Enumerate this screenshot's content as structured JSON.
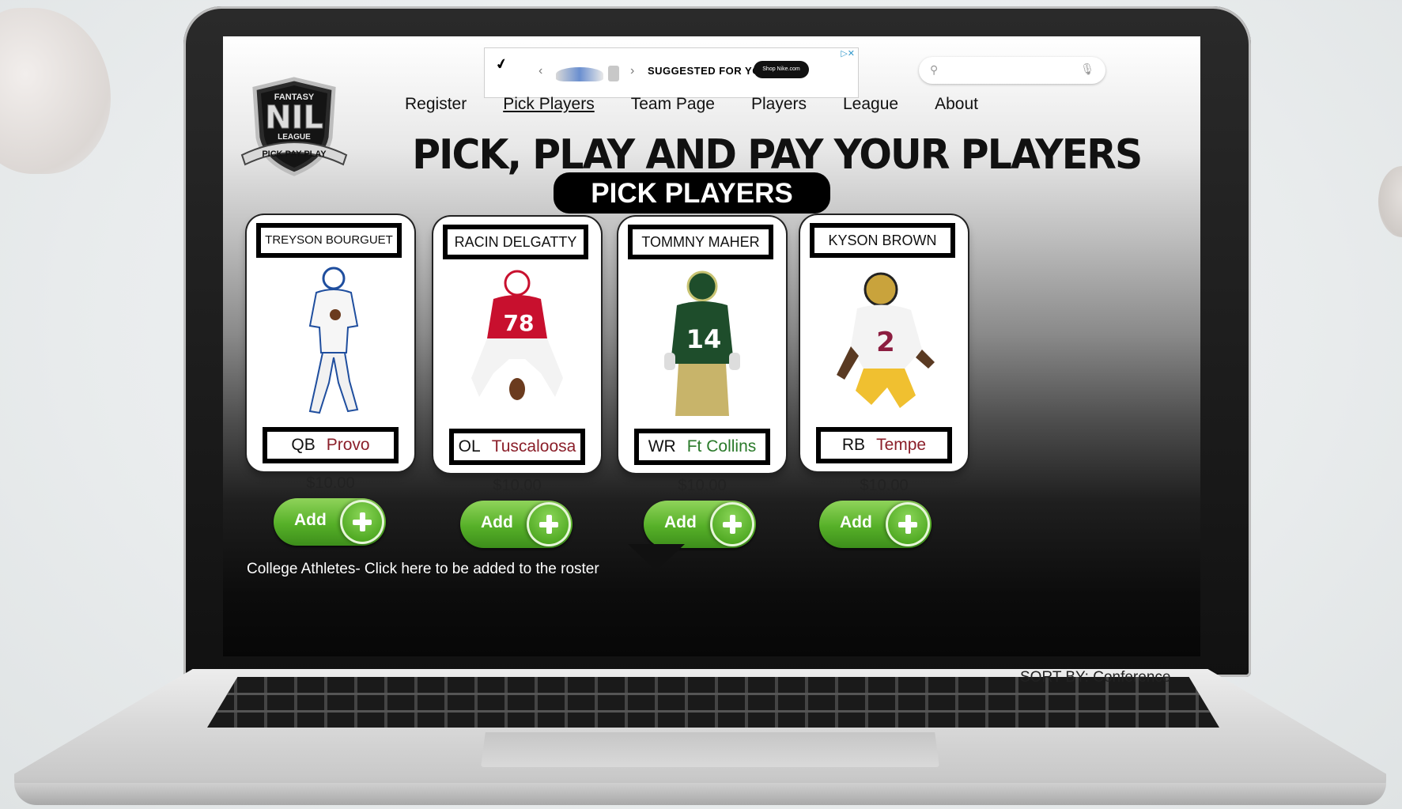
{
  "ad": {
    "suggested_text": "SUGGESTED FOR YOU.",
    "shop_label": "Shop Nike.com",
    "adchoice": "▷✕"
  },
  "search": {
    "placeholder": ""
  },
  "logo": {
    "top_text": "FANTASY",
    "main_text": "NIL",
    "sub_text": "LEAGUE",
    "ribbon_text": "PICK PAY PLAY"
  },
  "nav": {
    "items": [
      {
        "label": "Register"
      },
      {
        "label": "Pick Players"
      },
      {
        "label": "Team Page"
      },
      {
        "label": "Players"
      },
      {
        "label": "League"
      },
      {
        "label": "About"
      }
    ]
  },
  "headline": "PICK, PLAY AND PAY YOUR PLAYERS",
  "banner": "PICK PLAYERS",
  "players": [
    {
      "name": "TREYSON BOURGUET",
      "position": "QB",
      "city": "Provo",
      "price": "$10.00",
      "add_label": "Add",
      "jersey": "",
      "jersey_color": "#ffffff",
      "accent": "#1f4e9e"
    },
    {
      "name": "RACIN DELGATTY",
      "position": "OL",
      "city": "Tuscaloosa",
      "price": "$10.00",
      "add_label": "Add",
      "jersey": "78",
      "jersey_color": "#c8102e",
      "accent": "#ffffff"
    },
    {
      "name": "TOMMNY MAHER",
      "position": "WR",
      "city": "Ft Collins",
      "price": "$10.00",
      "add_label": "Add",
      "jersey": "14",
      "jersey_color": "#1e4d2b",
      "accent": "#c8c372"
    },
    {
      "name": "KYSON BROWN",
      "position": "RB",
      "city": "Tempe",
      "price": "$10.00",
      "add_label": "Add",
      "jersey": "2",
      "jersey_color": "#f3f3f3",
      "accent": "#8c1d40"
    }
  ],
  "roster_link": "College Athletes- Click here to be added to the roster",
  "sort": "SORT BY: Conference",
  "colors": {
    "add_green": "#56b028",
    "city_maroon": "#8b1f2a",
    "city_green": "#2a7a2a"
  }
}
